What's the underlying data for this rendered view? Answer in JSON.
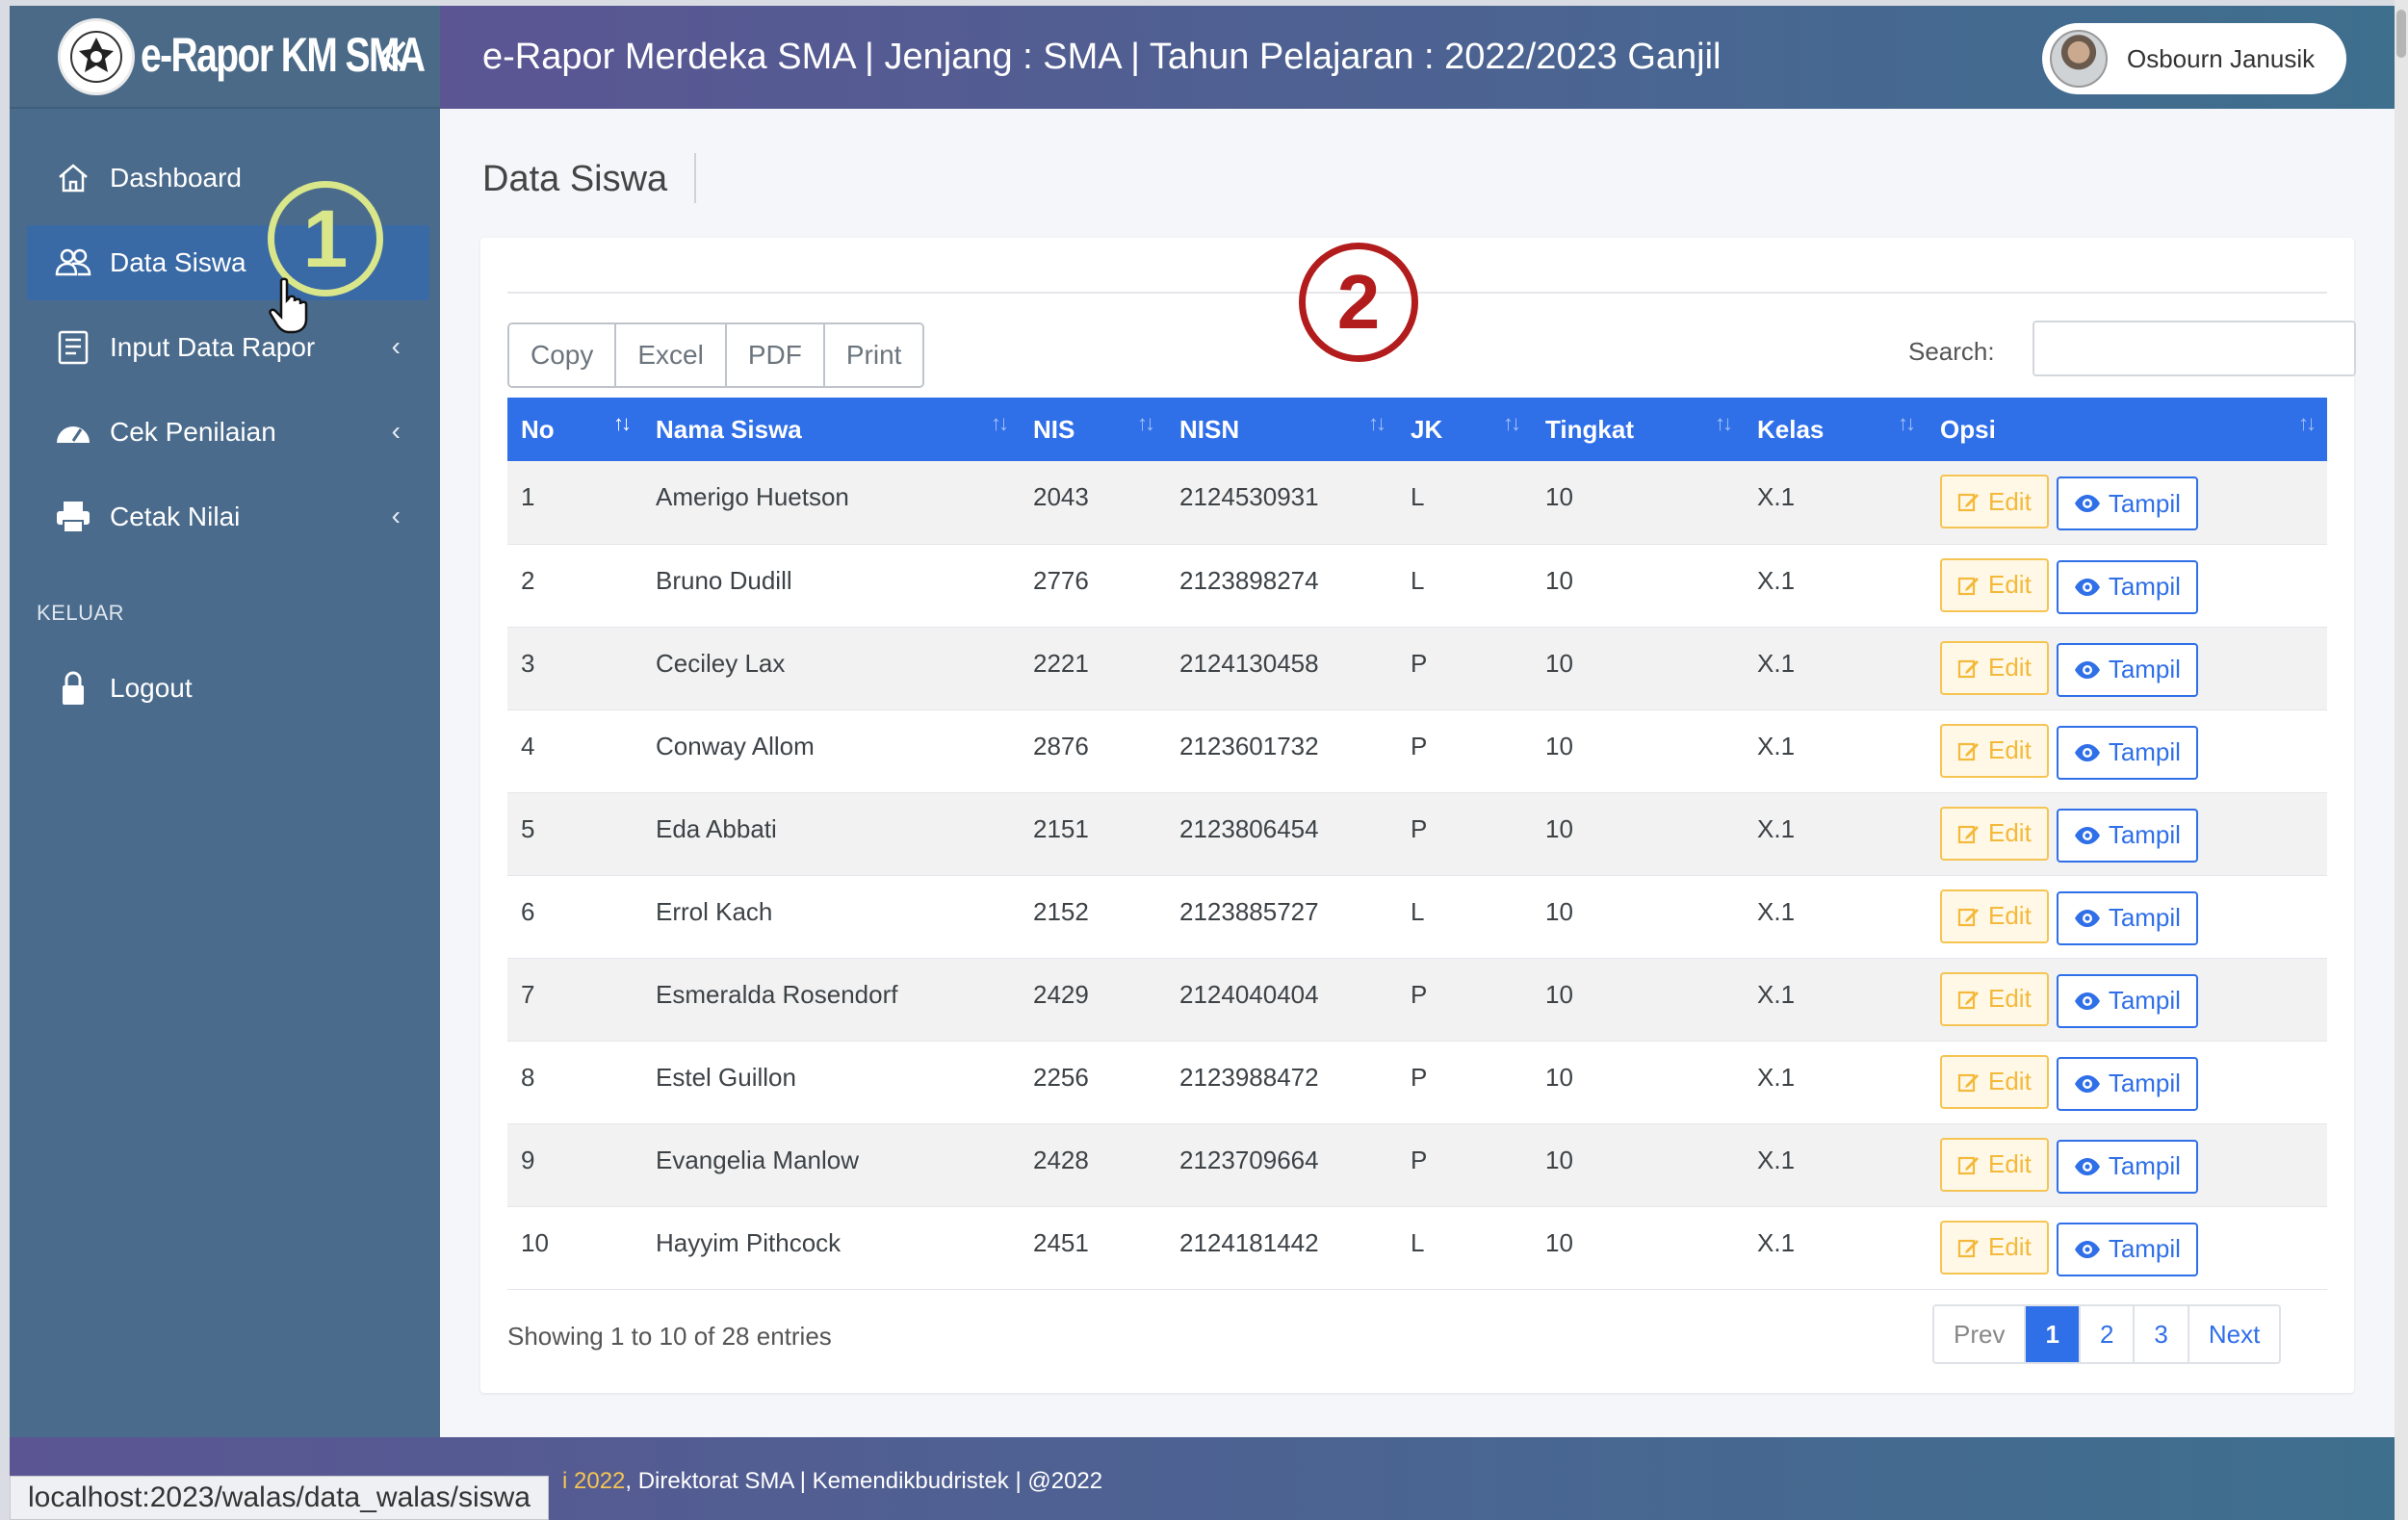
{
  "brand": {
    "name": "e-Rapor KM SMA",
    "collapse_icon": "double-chevron-left-icon"
  },
  "header": {
    "title": "e-Rapor Merdeka SMA | Jenjang : SMA | Tahun Pelajaran : 2022/2023 Ganjil",
    "user_name": "Osbourn Janusik"
  },
  "sidebar": {
    "items": [
      {
        "label": "Dashboard",
        "icon": "home-icon"
      },
      {
        "label": "Data Siswa",
        "icon": "users-icon"
      },
      {
        "label": "Input Data Rapor",
        "icon": "form-icon"
      },
      {
        "label": "Cek Penilaian",
        "icon": "dashboard-gauge-icon"
      },
      {
        "label": "Cetak Nilai",
        "icon": "printer-icon"
      }
    ],
    "section_header": "KELUAR",
    "logout_label": "Logout"
  },
  "page": {
    "title": "Data Siswa"
  },
  "export_buttons": [
    "Copy",
    "Excel",
    "PDF",
    "Print"
  ],
  "search": {
    "label": "Search:",
    "value": ""
  },
  "table": {
    "headers": [
      "No",
      "Nama Siswa",
      "NIS",
      "NISN",
      "JK",
      "Tingkat",
      "Kelas",
      "Opsi"
    ],
    "edit_label": "Edit",
    "view_label": "Tampil",
    "rows": [
      [
        "1",
        "Amerigo Huetson",
        "2043",
        "2124530931",
        "L",
        "10",
        "X.1"
      ],
      [
        "2",
        "Bruno Dudill",
        "2776",
        "2123898274",
        "L",
        "10",
        "X.1"
      ],
      [
        "3",
        "Ceciley Lax",
        "2221",
        "2124130458",
        "P",
        "10",
        "X.1"
      ],
      [
        "4",
        "Conway Allom",
        "2876",
        "2123601732",
        "P",
        "10",
        "X.1"
      ],
      [
        "5",
        "Eda Abbati",
        "2151",
        "2123806454",
        "P",
        "10",
        "X.1"
      ],
      [
        "6",
        "Errol Kach",
        "2152",
        "2123885727",
        "L",
        "10",
        "X.1"
      ],
      [
        "7",
        "Esmeralda Rosendorf",
        "2429",
        "2124040404",
        "P",
        "10",
        "X.1"
      ],
      [
        "8",
        "Estel Guillon",
        "2256",
        "2123988472",
        "P",
        "10",
        "X.1"
      ],
      [
        "9",
        "Evangelia Manlow",
        "2428",
        "2123709664",
        "P",
        "10",
        "X.1"
      ],
      [
        "10",
        "Hayyim Pithcock",
        "2451",
        "2124181442",
        "L",
        "10",
        "X.1"
      ]
    ]
  },
  "pagination": {
    "info": "Showing 1 to 10 of 28 entries",
    "prev": "Prev",
    "pages": [
      "1",
      "2",
      "3"
    ],
    "active_page": "1",
    "next": "Next"
  },
  "footer": {
    "year_fragment": "i 2022",
    "text": ", Direktorat SMA | Kemendikbudristek | @2022"
  },
  "status_bar_url": "localhost:2023/walas/data_walas/siswa",
  "annotations": {
    "callout_1": "1",
    "callout_2": "2"
  },
  "colors": {
    "sidebar": "#4a6b8c",
    "active_nav": "#3a6aa6",
    "table_header": "#2f6fe8",
    "edit": "#f4b93a",
    "callout_1": "#d9e68a",
    "callout_2": "#b21c1c"
  }
}
